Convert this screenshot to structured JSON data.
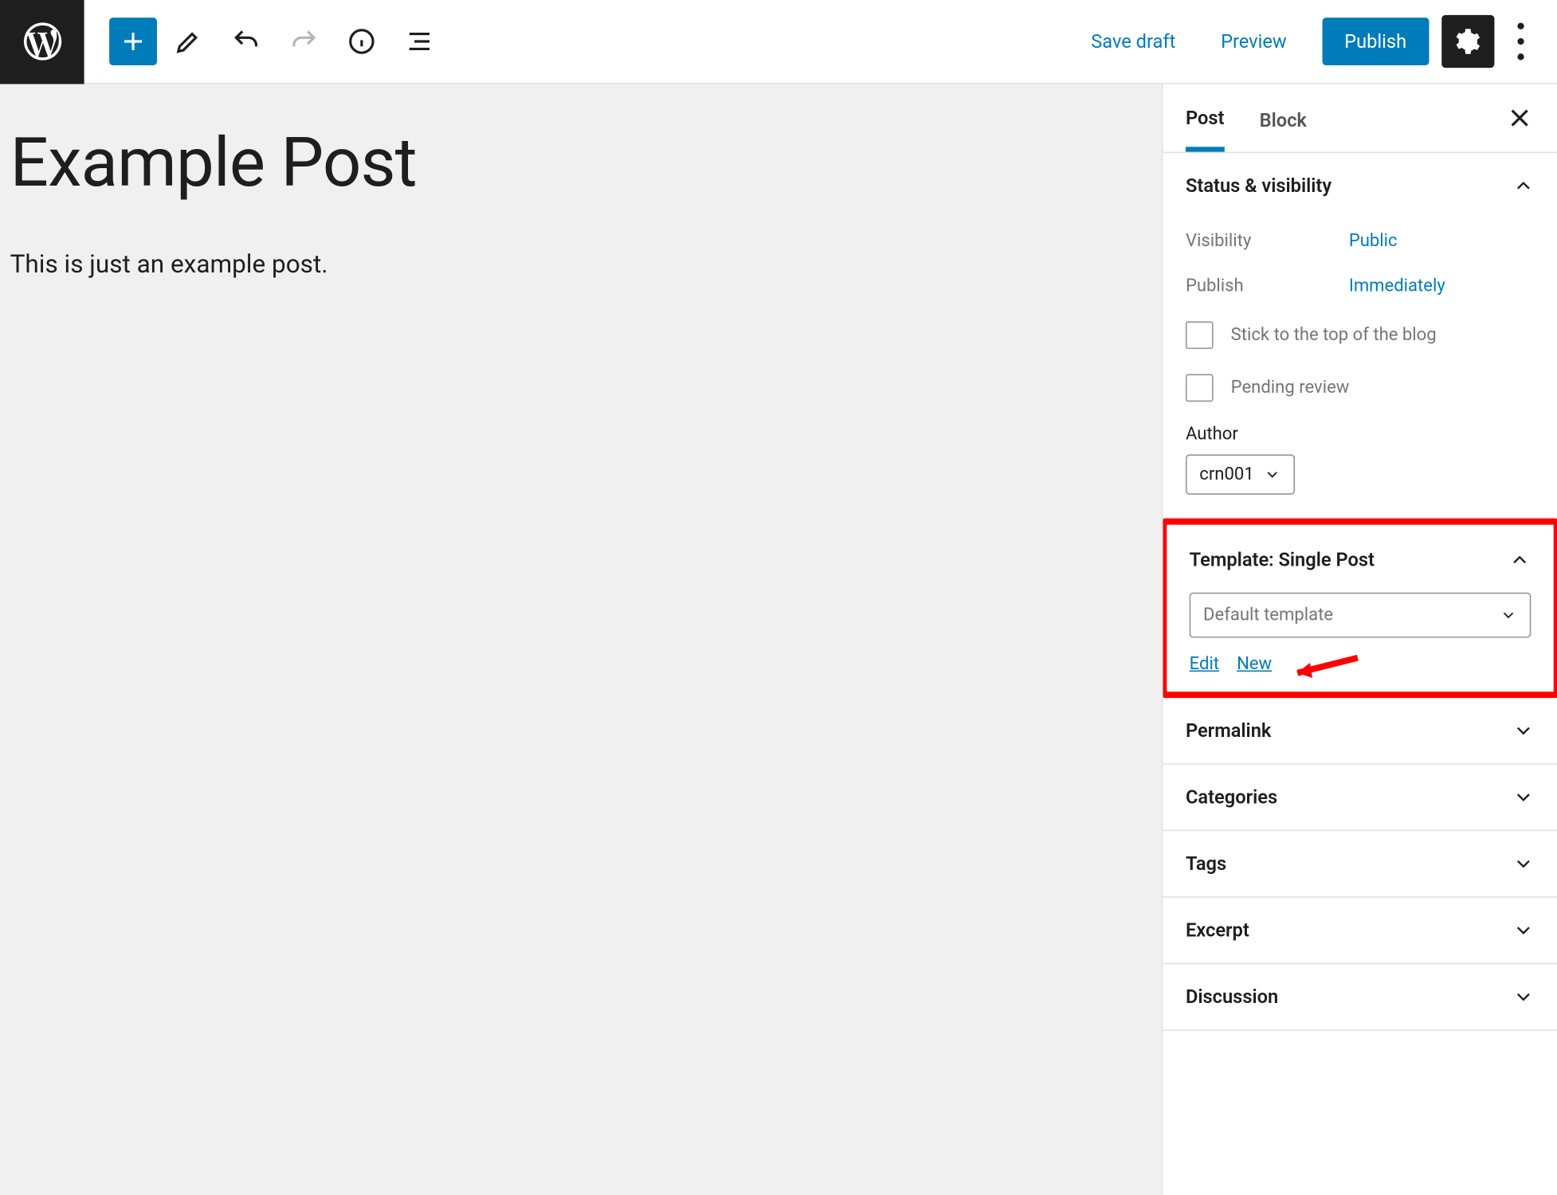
{
  "toolbar": {
    "save_draft": "Save draft",
    "preview": "Preview",
    "publish": "Publish"
  },
  "post": {
    "title": "Example Post",
    "body": "This is just an example post."
  },
  "sidebar": {
    "tabs": {
      "post": "Post",
      "block": "Block"
    },
    "status": {
      "title": "Status & visibility",
      "visibility_label": "Visibility",
      "visibility_value": "Public",
      "publish_label": "Publish",
      "publish_value": "Immediately",
      "stick_label": "Stick to the top of the blog",
      "pending_label": "Pending review",
      "author_label": "Author",
      "author_value": "crn001"
    },
    "template": {
      "title": "Template: Single Post",
      "select_value": "Default template",
      "edit": "Edit",
      "new": "New"
    },
    "panels": {
      "permalink": "Permalink",
      "categories": "Categories",
      "tags": "Tags",
      "excerpt": "Excerpt",
      "discussion": "Discussion"
    }
  }
}
